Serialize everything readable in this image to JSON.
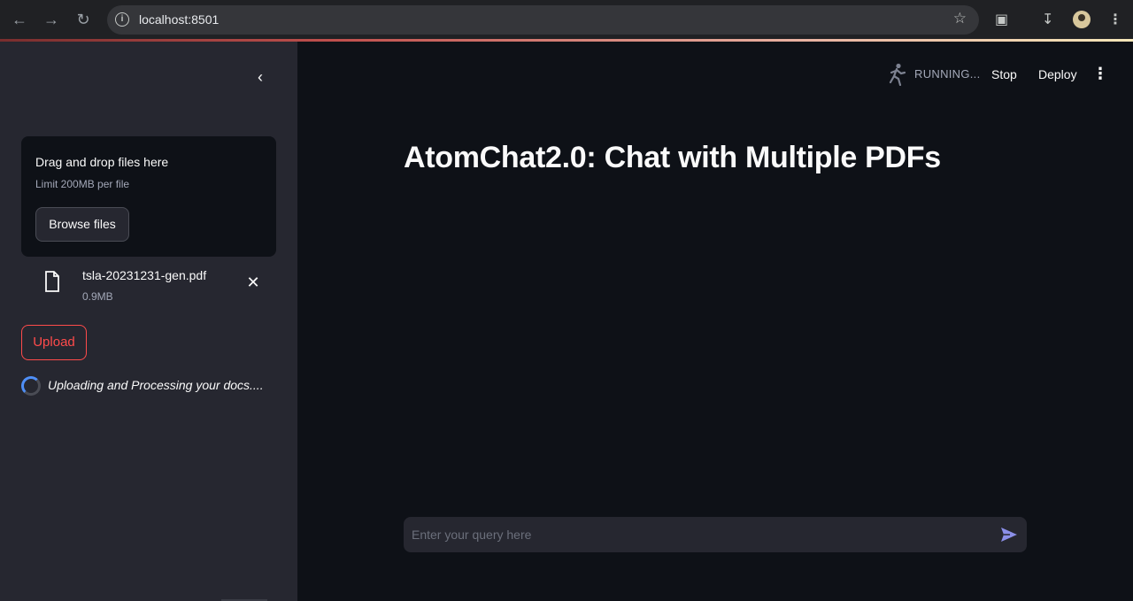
{
  "browser": {
    "url": "localhost:8501"
  },
  "sidebar": {
    "uploader": {
      "title": "Drag and drop files here",
      "limit": "Limit 200MB per file",
      "browse_label": "Browse files"
    },
    "file": {
      "name": "tsla-20231231-gen.pdf",
      "size": "0.9MB"
    },
    "upload_label": "Upload",
    "status_text": "Uploading and Processing your docs...."
  },
  "header": {
    "running_label": "RUNNING...",
    "stop_label": "Stop",
    "deploy_label": "Deploy"
  },
  "main": {
    "title": "AtomChat2.0: Chat with Multiple PDFs",
    "chat_placeholder": "Enter your query here"
  },
  "colors": {
    "accent": "#ff4b4b",
    "background": "#0e1117",
    "sidebar": "#262730"
  }
}
